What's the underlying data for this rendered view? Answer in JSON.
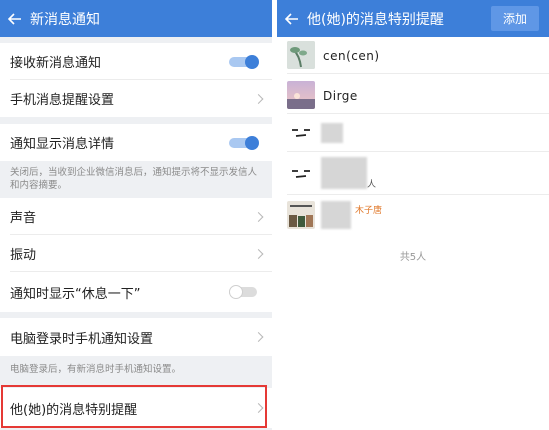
{
  "left": {
    "title": "新消息通知",
    "items": [
      {
        "label": "接收新消息通知",
        "toggle": true
      },
      {
        "label": "手机消息提醒设置"
      },
      {
        "label": "通知显示消息详情",
        "toggle": true
      },
      {
        "label": "声音"
      },
      {
        "label": "振动"
      },
      {
        "label": "通知时显示“休息一下”",
        "toggle": false
      },
      {
        "label": "电脑登录时手机通知设置"
      },
      {
        "label": "他(她)的消息特别提醒"
      }
    ],
    "hint_details": "关闭后，当收到企业微信消息后，通知提示将不显示发信人和内容摘要。",
    "hint_pc": "电脑登录后，有新消息时手机通知设置。"
  },
  "right": {
    "title": "他(她)的消息特别提醒",
    "add_label": "添加",
    "contacts": [
      {
        "name": "cen(cen)",
        "avatar": "plant-photo-avatar"
      },
      {
        "name": "Dirge",
        "avatar": "sunset-photo-avatar"
      },
      {
        "name": "",
        "avatar": "face-doodle-avatar"
      },
      {
        "name": "",
        "avatar": "face-doodle-avatar",
        "tag": "",
        "sub": "人"
      },
      {
        "name": "",
        "avatar": "collage-photo-avatar",
        "tag": "木子唐"
      }
    ],
    "count_label": "共5人"
  },
  "colors": {
    "header": "#3d7fd9",
    "toggle_on": "#3d7fd9",
    "highlight": "#e53935"
  },
  "icons": {
    "back": "back-arrow-icon",
    "chevron": "chevron-right-icon"
  }
}
